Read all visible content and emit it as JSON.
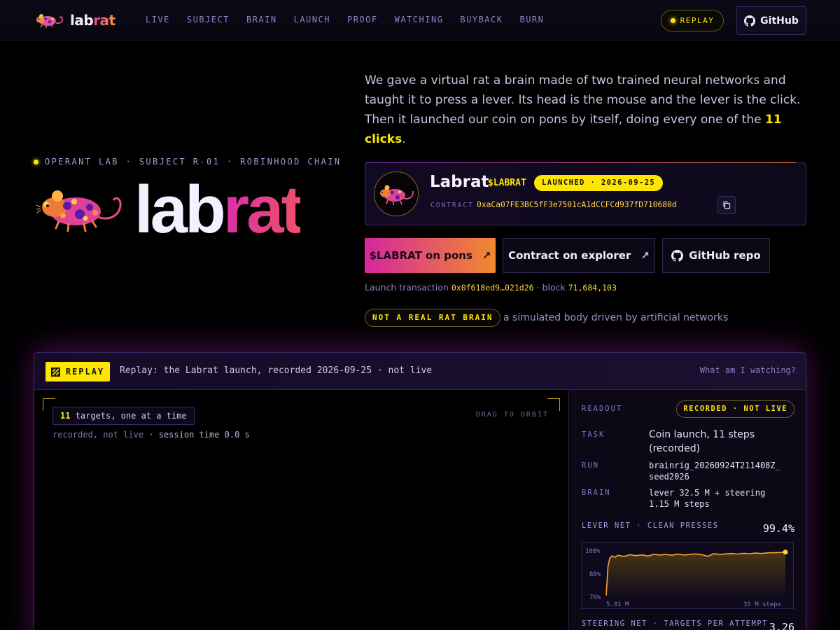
{
  "nav": {
    "logo_a": "lab",
    "logo_b": "rat",
    "links": [
      "LIVE",
      "SUBJECT",
      "BRAIN",
      "LAUNCH",
      "PROOF",
      "WATCHING",
      "BUYBACK",
      "BURN"
    ],
    "replay_label": "REPLAY",
    "github_label": "GitHub"
  },
  "hero": {
    "eyebrow": "OPERANT LAB · SUBJECT R-01 · ROBINHOOD CHAIN",
    "title_a": "lab",
    "title_b": "rat",
    "intro_before": "We gave a virtual rat a brain made of two trained neural networks and taught it to press a lever. Its head is the mouse and the lever is the click. Then it launched our coin on pons by itself, doing every one of the ",
    "intro_highlight": "11 clicks",
    "intro_after": "."
  },
  "token": {
    "name": "Labrat",
    "ticker": "$LABRAT",
    "badge": "LAUNCHED · 2026-09-25",
    "contract_label": "CONTRACT",
    "contract_address": "0xaCa07FE3BC5fF3e7501cA1dCCFCd937fD710680d"
  },
  "actions": {
    "pons": "$LABRAT on pons",
    "explorer": "Contract on explorer",
    "github": "GitHub repo"
  },
  "launch": {
    "prefix": "Launch transaction",
    "tx": "0x0f618ed9…021d26",
    "block_label": "· block",
    "block": "71,684,103"
  },
  "disclaimer": {
    "badge": "NOT A REAL RAT BRAIN",
    "text": "a simulated body driven by artificial networks"
  },
  "replay": {
    "badge": "REPLAY",
    "title": "Replay: the Labrat launch, recorded 2026-09-25 · not live",
    "what_link": "What am I watching?",
    "targets_count": "11",
    "targets_text": "targets, one at a time",
    "drag_hint": "DRAG TO ORBIT",
    "session_muted": "recorded, not live",
    "session_text": " · session time 0.0 s"
  },
  "readout": {
    "label": "READOUT",
    "badge": "RECORDED · NOT LIVE",
    "task_key": "TASK",
    "task_val": "Coin launch, 11 steps (recorded)",
    "run_key": "RUN",
    "run_val": "brainrig_20260924T211408Z_ seed2026",
    "brain_key": "BRAIN",
    "brain_val": "lever 32.5 M + steering 1.15 M steps",
    "lever_label": "LEVER NET · CLEAN PRESSES",
    "lever_val": "99.4%",
    "steer_label": "STEERING NET · TARGETS PER ATTEMPT",
    "steer_val": "3.26"
  },
  "chart_data": {
    "type": "area",
    "title": "",
    "xlabel": "",
    "ylabel": "",
    "x_tick_labels": [
      "5.01 M",
      "35 M steps"
    ],
    "y_tick_labels": [
      "100%",
      "88%",
      "76%"
    ],
    "ylim": [
      76,
      100
    ],
    "x": [
      5.01,
      5.3,
      5.6,
      6.0,
      6.5,
      7.0,
      8.0,
      9.0,
      10,
      11,
      12,
      13,
      14,
      15,
      16,
      17,
      18,
      19,
      20,
      21,
      22,
      23,
      24,
      25,
      26,
      27,
      28,
      29,
      30,
      31,
      32,
      33,
      34,
      35
    ],
    "series": [
      {
        "values": [
          77.5,
          92,
          96.2,
          97.5,
          96.8,
          97.8,
          97.2,
          98.1,
          97.6,
          98.0,
          97.4,
          98.3,
          97.9,
          98.2,
          97.8,
          98.4,
          97.9,
          98.2,
          98.5,
          98.1,
          97.3,
          98.6,
          98.2,
          98.5,
          98.7,
          98.4,
          98.8,
          98.6,
          98.9,
          98.7,
          99.0,
          99.1,
          99.2,
          99.4
        ]
      }
    ],
    "grid": false,
    "colors": {
      "line": "#f5a530",
      "fill_top": "#3a2a14",
      "endpoint": "#ffd447"
    }
  }
}
